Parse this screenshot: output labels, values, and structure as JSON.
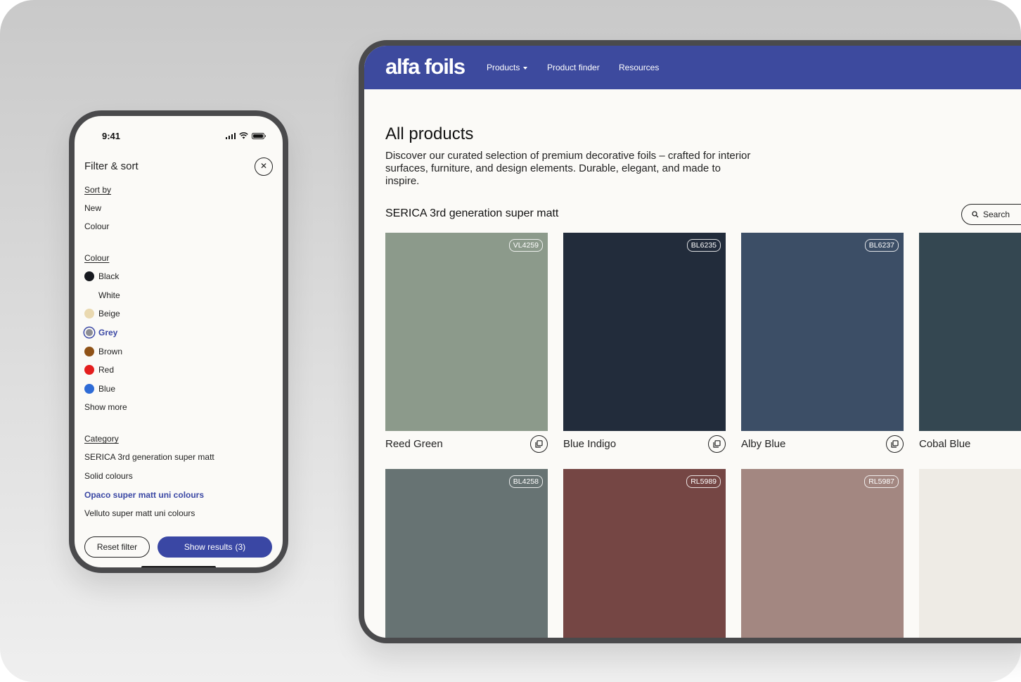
{
  "phone": {
    "status": {
      "time": "9:41"
    },
    "filter": {
      "title": "Filter & sort",
      "sort_heading": "Sort by",
      "sort_options": [
        "New",
        "Colour"
      ],
      "colour_heading": "Colour",
      "colours": [
        {
          "label": "Black",
          "swatch": "#17191f",
          "selected": false
        },
        {
          "label": "White",
          "swatch": "#fbfaf7",
          "selected": false
        },
        {
          "label": "Beige",
          "swatch": "#ead9b0",
          "selected": false
        },
        {
          "label": "Grey",
          "swatch": "#8e8e93",
          "selected": true
        },
        {
          "label": "Brown",
          "swatch": "#8f5217",
          "selected": false
        },
        {
          "label": "Red",
          "swatch": "#e41e1e",
          "selected": false
        },
        {
          "label": "Blue",
          "swatch": "#2e6bd6",
          "selected": false
        }
      ],
      "show_more": "Show more",
      "category_heading": "Category",
      "categories": [
        {
          "label": "SERICA 3rd generation super matt",
          "active": false
        },
        {
          "label": "Solid colours",
          "active": false
        },
        {
          "label": "Opaco super matt uni colours",
          "active": true
        },
        {
          "label": "Velluto super matt uni colours",
          "active": false
        }
      ],
      "reset_label": "Reset filter",
      "results_label": "Show results",
      "results_count": "(3)"
    }
  },
  "tablet": {
    "brand": "alfa foils",
    "nav": [
      {
        "label": "Products",
        "has_dropdown": true
      },
      {
        "label": "Product finder",
        "has_dropdown": false
      },
      {
        "label": "Resources",
        "has_dropdown": false
      }
    ],
    "page_title": "All products",
    "page_description": "Discover our curated selection of premium decorative foils – crafted for interior surfaces, furniture, and design elements. Durable, elegant, and made to inspire.",
    "section_title": "SERICA 3rd generation super matt",
    "search_label": "Search",
    "products_row1": [
      {
        "code": "VL4259",
        "name": "Reed Green",
        "color": "#8c9a8b"
      },
      {
        "code": "BL6235",
        "name": "Blue Indigo",
        "color": "#222c3b"
      },
      {
        "code": "BL6237",
        "name": "Alby Blue",
        "color": "#3c4e66"
      },
      {
        "code": "",
        "name": "Cobal Blue",
        "color": "#344751"
      }
    ],
    "products_row2": [
      {
        "code": "BL4258",
        "color": "#677373"
      },
      {
        "code": "RL5989",
        "color": "#754644"
      },
      {
        "code": "RL5987",
        "color": "#a38781"
      },
      {
        "code": "",
        "color": "#eeebe5"
      }
    ],
    "colors": {
      "brand_blue": "#3d4a9e",
      "accent": "#3a47a4"
    }
  }
}
